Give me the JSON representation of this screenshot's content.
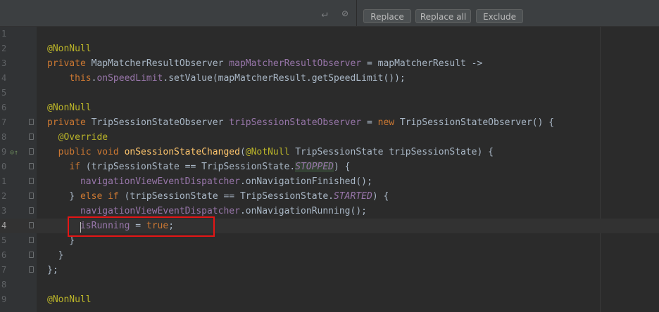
{
  "toolbar": {
    "replace_label": "Replace",
    "replace_all_label": "Replace all",
    "exclude_label": "Exclude",
    "icons": [
      "enter-icon",
      "regex-icon"
    ]
  },
  "editor": {
    "lines": [
      {
        "num": "1",
        "html": ""
      },
      {
        "num": "2",
        "html": "<span class='ann'>@NonNull</span>"
      },
      {
        "num": "3",
        "html": "<span class='kw'>private</span> MapMatcherResultObserver <span class='fld'>mapMatcherResultObserver</span> = mapMatcherResult -&gt;"
      },
      {
        "num": "4",
        "html": "    <span class='kw'>this</span>.<span class='fld'>onSpeedLimit</span>.setValue(mapMatcherResult.getSpeedLimit());"
      },
      {
        "num": "5",
        "html": ""
      },
      {
        "num": "6",
        "html": "<span class='ann'>@NonNull</span>"
      },
      {
        "num": "7",
        "html": "<span class='kw'>private</span> TripSessionStateObserver <span class='fld'>tripSessionStateObserver</span> = <span class='kw'>new</span> TripSessionStateObserver() {"
      },
      {
        "num": "8",
        "html": "  <span class='ann'>@Override</span>"
      },
      {
        "num": "9",
        "html": "  <span class='kw'>public void</span> <span class='fn'>onSessionStateChanged</span>(<span class='ann'>@NotNull</span> TripSessionState tripSessionState) {"
      },
      {
        "num": "0",
        "html": "    <span class='kw'>if</span> (tripSessionState == TripSessionState.<span class='static-it hl-green'>STOPPED</span>) {"
      },
      {
        "num": "1",
        "html": "      <span class='fld'>navigationViewEventDispatcher</span>.onNavigationFinished();"
      },
      {
        "num": "2",
        "html": "    } <span class='kw'>else if</span> (tripSessionState == TripSessionState.<span class='static-it'>STARTED</span>) {"
      },
      {
        "num": "3",
        "html": "      <span class='fld'>navigationViewEventDispatcher</span>.onNavigationRunning();"
      },
      {
        "num": "4",
        "html": "      <span class='fld'>isRunning</span> = <span class='kw'>true</span>;"
      },
      {
        "num": "5",
        "html": "    }"
      },
      {
        "num": "6",
        "html": "  }"
      },
      {
        "num": "7",
        "html": "};"
      },
      {
        "num": "8",
        "html": ""
      },
      {
        "num": "9",
        "html": "<span class='ann'>@NonNull</span>"
      }
    ],
    "current_line_index": 13,
    "fold_lines": [
      6,
      7,
      8,
      9,
      10,
      11,
      12,
      13,
      14,
      15,
      16
    ]
  }
}
